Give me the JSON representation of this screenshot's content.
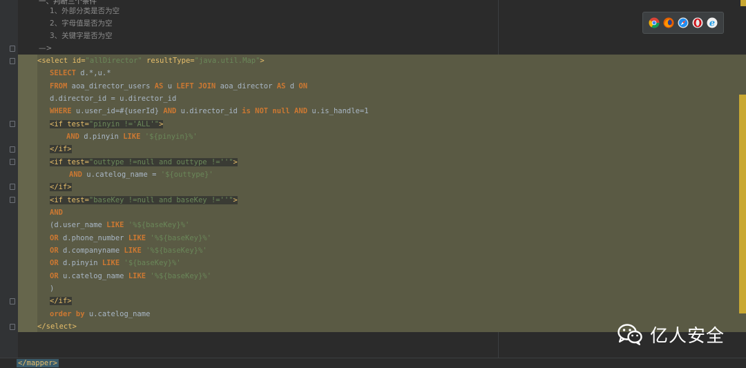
{
  "comments": {
    "title": "一、判断三个条件",
    "items": [
      "1、外部分类是否为空",
      "2、字母值是否为空",
      "3、关键字是否为空"
    ],
    "close": "—>"
  },
  "select_open": {
    "tag_open": "<select ",
    "id_attr": "id=",
    "id_val": "\"allDirector\"",
    "rt_attr": " resultType=",
    "rt_val": "\"java.util.Map\"",
    "tag_end": ">"
  },
  "sql": {
    "select_kw": "SELECT",
    "select_rest": " d.*,u.*",
    "from_kw": "FROM",
    "from_t1": " aoa_director_users ",
    "as_kw": "AS",
    "from_a1": " u ",
    "left_join_kw": "LEFT JOIN",
    "from_t2": " aoa_director ",
    "as2_kw": "AS",
    "from_a2": " d ",
    "on_kw": "ON",
    "join_cond": "d.director_id = u.director_id",
    "where_kw": "WHERE",
    "where_1": " u.user_id=#{userId} ",
    "and_kw": "AND",
    "where_2": " u.director_id ",
    "is_not_null_kw": "is NOT null",
    "where_3": " ",
    "and2_kw": "AND",
    "where_4": " u.is_handle=1"
  },
  "if1": {
    "open_tag": "<if test=",
    "cond": "\"pinyin !='ALL'\"",
    "gt": ">",
    "and_kw": "AND",
    "body": " d.pinyin ",
    "like_kw": "LIKE",
    "val": " '${pinyin}%'",
    "close": "</if>"
  },
  "if2": {
    "open_tag": "<if test=",
    "cond": "\"outtype !=null and outtype !=''\"",
    "gt": ">",
    "and_kw": "AND",
    "body": " u.catelog_name = ",
    "val": "'${outtype}'",
    "close": "</if>"
  },
  "if3": {
    "open_tag": "<if test=",
    "cond": "\"baseKey !=null and baseKey !=''\"",
    "gt": ">",
    "and_kw": "AND",
    "l1_a": "(d.user_name ",
    "l1_like": "LIKE",
    "l1_v": " '%${baseKey}%'",
    "l2_or": "OR",
    "l2_a": " d.phone_number ",
    "l2_like": "LIKE",
    "l2_v": " '%${baseKey}%'",
    "l3_or": "OR",
    "l3_a": " d.companyname ",
    "l3_like": "LIKE",
    "l3_v": " '%${baseKey}%'",
    "l4_or": "OR",
    "l4_a": " d.pinyin ",
    "l4_like": "LIKE",
    "l4_v": " '${baseKey}%'",
    "l5_or": "OR",
    "l5_a": " u.catelog_name ",
    "l5_like": "LIKE",
    "l5_v": " '%${baseKey}%'",
    "paren": ")",
    "close": "</if>"
  },
  "order": {
    "kw": "order by",
    "rest": " u.catelog_name"
  },
  "select_close": "</select>",
  "mapper_close": "</mapper>",
  "watermark": "亿人安全",
  "browser_icons": [
    "chrome-icon",
    "firefox-icon",
    "safari-icon",
    "opera-icon",
    "ie-icon"
  ]
}
